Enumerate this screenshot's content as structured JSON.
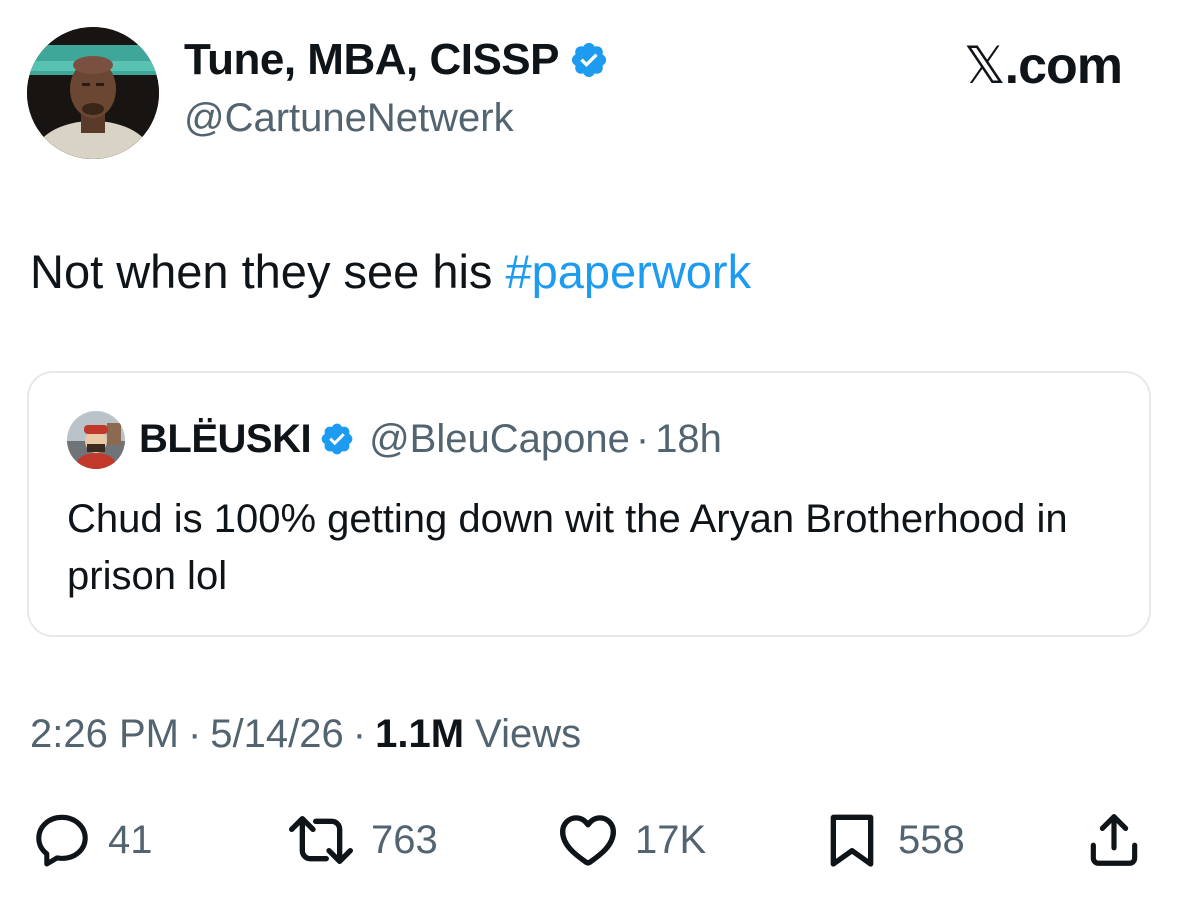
{
  "author": {
    "display_name": "Tune, MBA, CISSP",
    "handle": "@CartuneNetwerk",
    "verified": true
  },
  "brand": {
    "glyph": "𝕏",
    "suffix": ".com"
  },
  "tweet": {
    "text_prefix": "Not when they see his ",
    "hashtag": "#paperwork"
  },
  "quoted_tweet": {
    "display_name": "BLËUSKI",
    "handle": "@BleuCapone",
    "separator": "·",
    "time_ago": "18h",
    "verified": true,
    "text": "Chud is 100% getting down wit the Aryan Brotherhood in prison lol"
  },
  "meta": {
    "time": "2:26 PM",
    "separator": "·",
    "date": "5/14/26",
    "views_count": "1.1M",
    "views_label": "Views"
  },
  "actions": {
    "replies": "41",
    "reposts": "763",
    "likes": "17K",
    "bookmarks": "558"
  },
  "icons": [
    "reply-icon",
    "repost-icon",
    "like-icon",
    "bookmark-icon",
    "share-icon",
    "verified-badge-icon"
  ],
  "colors": {
    "accent": "#1d9bf0",
    "text_primary": "#0f1419",
    "text_secondary": "#536471",
    "border": "#e6e9ec"
  }
}
